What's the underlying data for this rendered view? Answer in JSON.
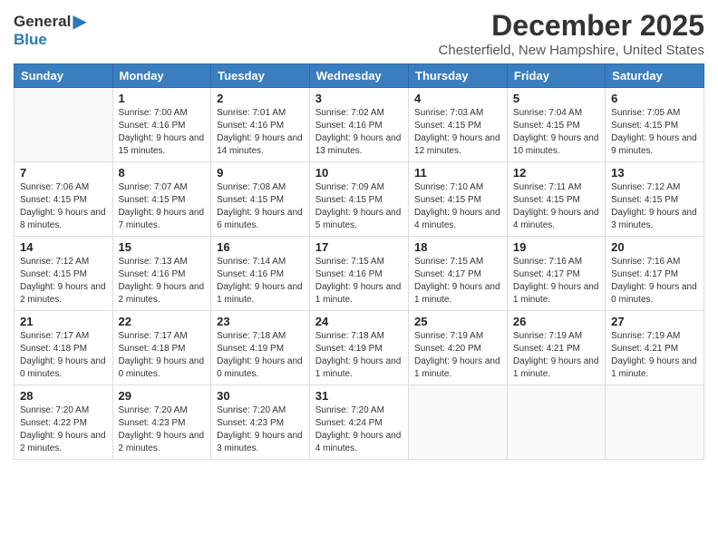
{
  "header": {
    "logo_general": "General",
    "logo_blue": "Blue",
    "month": "December 2025",
    "location": "Chesterfield, New Hampshire, United States"
  },
  "days_of_week": [
    "Sunday",
    "Monday",
    "Tuesday",
    "Wednesday",
    "Thursday",
    "Friday",
    "Saturday"
  ],
  "weeks": [
    [
      {
        "date": "",
        "sunrise": "",
        "sunset": "",
        "daylight": ""
      },
      {
        "date": "1",
        "sunrise": "Sunrise: 7:00 AM",
        "sunset": "Sunset: 4:16 PM",
        "daylight": "Daylight: 9 hours and 15 minutes."
      },
      {
        "date": "2",
        "sunrise": "Sunrise: 7:01 AM",
        "sunset": "Sunset: 4:16 PM",
        "daylight": "Daylight: 9 hours and 14 minutes."
      },
      {
        "date": "3",
        "sunrise": "Sunrise: 7:02 AM",
        "sunset": "Sunset: 4:16 PM",
        "daylight": "Daylight: 9 hours and 13 minutes."
      },
      {
        "date": "4",
        "sunrise": "Sunrise: 7:03 AM",
        "sunset": "Sunset: 4:15 PM",
        "daylight": "Daylight: 9 hours and 12 minutes."
      },
      {
        "date": "5",
        "sunrise": "Sunrise: 7:04 AM",
        "sunset": "Sunset: 4:15 PM",
        "daylight": "Daylight: 9 hours and 10 minutes."
      },
      {
        "date": "6",
        "sunrise": "Sunrise: 7:05 AM",
        "sunset": "Sunset: 4:15 PM",
        "daylight": "Daylight: 9 hours and 9 minutes."
      }
    ],
    [
      {
        "date": "7",
        "sunrise": "Sunrise: 7:06 AM",
        "sunset": "Sunset: 4:15 PM",
        "daylight": "Daylight: 9 hours and 8 minutes."
      },
      {
        "date": "8",
        "sunrise": "Sunrise: 7:07 AM",
        "sunset": "Sunset: 4:15 PM",
        "daylight": "Daylight: 9 hours and 7 minutes."
      },
      {
        "date": "9",
        "sunrise": "Sunrise: 7:08 AM",
        "sunset": "Sunset: 4:15 PM",
        "daylight": "Daylight: 9 hours and 6 minutes."
      },
      {
        "date": "10",
        "sunrise": "Sunrise: 7:09 AM",
        "sunset": "Sunset: 4:15 PM",
        "daylight": "Daylight: 9 hours and 5 minutes."
      },
      {
        "date": "11",
        "sunrise": "Sunrise: 7:10 AM",
        "sunset": "Sunset: 4:15 PM",
        "daylight": "Daylight: 9 hours and 4 minutes."
      },
      {
        "date": "12",
        "sunrise": "Sunrise: 7:11 AM",
        "sunset": "Sunset: 4:15 PM",
        "daylight": "Daylight: 9 hours and 4 minutes."
      },
      {
        "date": "13",
        "sunrise": "Sunrise: 7:12 AM",
        "sunset": "Sunset: 4:15 PM",
        "daylight": "Daylight: 9 hours and 3 minutes."
      }
    ],
    [
      {
        "date": "14",
        "sunrise": "Sunrise: 7:12 AM",
        "sunset": "Sunset: 4:15 PM",
        "daylight": "Daylight: 9 hours and 2 minutes."
      },
      {
        "date": "15",
        "sunrise": "Sunrise: 7:13 AM",
        "sunset": "Sunset: 4:16 PM",
        "daylight": "Daylight: 9 hours and 2 minutes."
      },
      {
        "date": "16",
        "sunrise": "Sunrise: 7:14 AM",
        "sunset": "Sunset: 4:16 PM",
        "daylight": "Daylight: 9 hours and 1 minute."
      },
      {
        "date": "17",
        "sunrise": "Sunrise: 7:15 AM",
        "sunset": "Sunset: 4:16 PM",
        "daylight": "Daylight: 9 hours and 1 minute."
      },
      {
        "date": "18",
        "sunrise": "Sunrise: 7:15 AM",
        "sunset": "Sunset: 4:17 PM",
        "daylight": "Daylight: 9 hours and 1 minute."
      },
      {
        "date": "19",
        "sunrise": "Sunrise: 7:16 AM",
        "sunset": "Sunset: 4:17 PM",
        "daylight": "Daylight: 9 hours and 1 minute."
      },
      {
        "date": "20",
        "sunrise": "Sunrise: 7:16 AM",
        "sunset": "Sunset: 4:17 PM",
        "daylight": "Daylight: 9 hours and 0 minutes."
      }
    ],
    [
      {
        "date": "21",
        "sunrise": "Sunrise: 7:17 AM",
        "sunset": "Sunset: 4:18 PM",
        "daylight": "Daylight: 9 hours and 0 minutes."
      },
      {
        "date": "22",
        "sunrise": "Sunrise: 7:17 AM",
        "sunset": "Sunset: 4:18 PM",
        "daylight": "Daylight: 9 hours and 0 minutes."
      },
      {
        "date": "23",
        "sunrise": "Sunrise: 7:18 AM",
        "sunset": "Sunset: 4:19 PM",
        "daylight": "Daylight: 9 hours and 0 minutes."
      },
      {
        "date": "24",
        "sunrise": "Sunrise: 7:18 AM",
        "sunset": "Sunset: 4:19 PM",
        "daylight": "Daylight: 9 hours and 1 minute."
      },
      {
        "date": "25",
        "sunrise": "Sunrise: 7:19 AM",
        "sunset": "Sunset: 4:20 PM",
        "daylight": "Daylight: 9 hours and 1 minute."
      },
      {
        "date": "26",
        "sunrise": "Sunrise: 7:19 AM",
        "sunset": "Sunset: 4:21 PM",
        "daylight": "Daylight: 9 hours and 1 minute."
      },
      {
        "date": "27",
        "sunrise": "Sunrise: 7:19 AM",
        "sunset": "Sunset: 4:21 PM",
        "daylight": "Daylight: 9 hours and 1 minute."
      }
    ],
    [
      {
        "date": "28",
        "sunrise": "Sunrise: 7:20 AM",
        "sunset": "Sunset: 4:22 PM",
        "daylight": "Daylight: 9 hours and 2 minutes."
      },
      {
        "date": "29",
        "sunrise": "Sunrise: 7:20 AM",
        "sunset": "Sunset: 4:23 PM",
        "daylight": "Daylight: 9 hours and 2 minutes."
      },
      {
        "date": "30",
        "sunrise": "Sunrise: 7:20 AM",
        "sunset": "Sunset: 4:23 PM",
        "daylight": "Daylight: 9 hours and 3 minutes."
      },
      {
        "date": "31",
        "sunrise": "Sunrise: 7:20 AM",
        "sunset": "Sunset: 4:24 PM",
        "daylight": "Daylight: 9 hours and 4 minutes."
      },
      {
        "date": "",
        "sunrise": "",
        "sunset": "",
        "daylight": ""
      },
      {
        "date": "",
        "sunrise": "",
        "sunset": "",
        "daylight": ""
      },
      {
        "date": "",
        "sunrise": "",
        "sunset": "",
        "daylight": ""
      }
    ]
  ]
}
